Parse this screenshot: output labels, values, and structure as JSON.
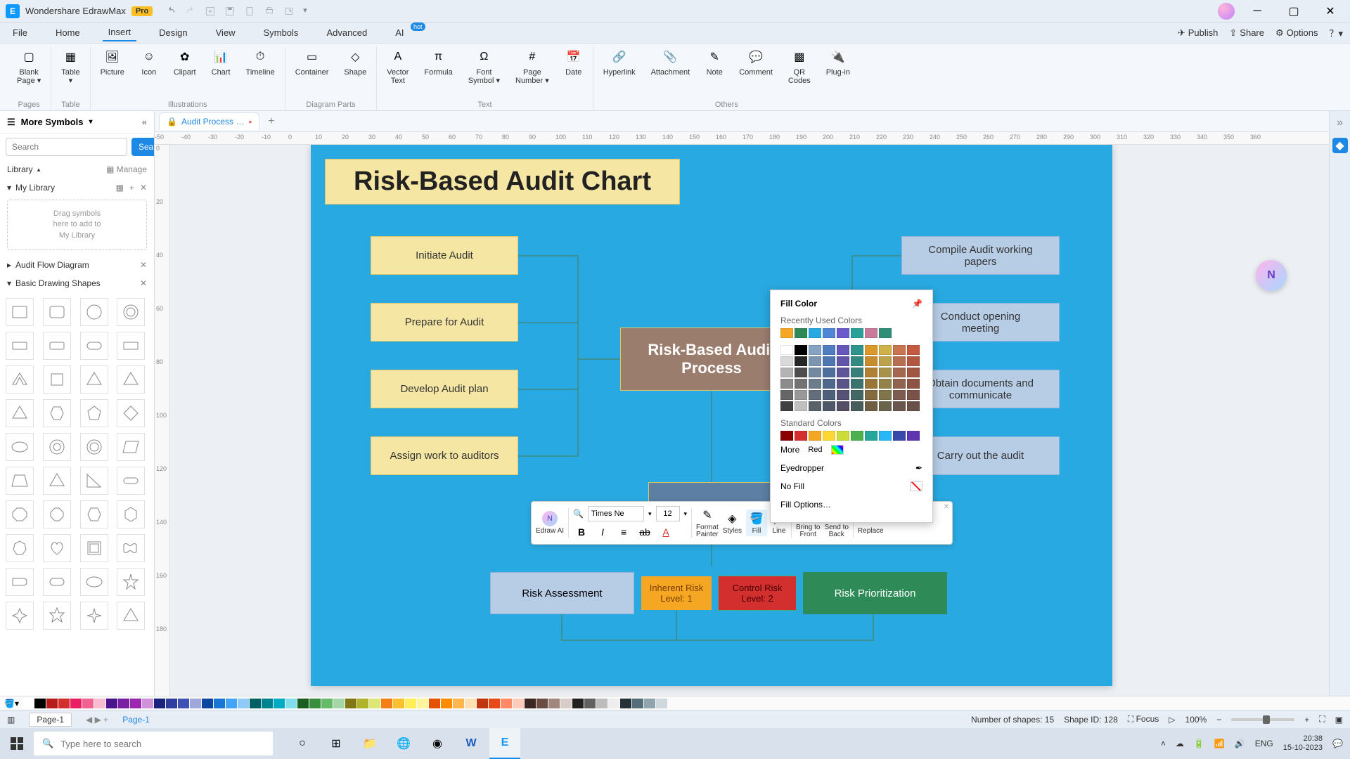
{
  "app": {
    "name": "Wondershare EdrawMax",
    "badge": "Pro"
  },
  "menu": {
    "items": [
      "File",
      "Home",
      "Insert",
      "Design",
      "View",
      "Symbols",
      "Advanced",
      "AI"
    ],
    "active": "Insert",
    "right": {
      "publish": "Publish",
      "share": "Share",
      "options": "Options"
    }
  },
  "ribbon": {
    "groups": [
      {
        "label": "Pages",
        "buttons": [
          {
            "name": "blank-page",
            "label": "Blank\nPage ▾"
          }
        ]
      },
      {
        "label": "Table",
        "buttons": [
          {
            "name": "table",
            "label": "Table\n▾"
          }
        ]
      },
      {
        "label": "Illustrations",
        "buttons": [
          {
            "name": "picture",
            "label": "Picture"
          },
          {
            "name": "icon",
            "label": "Icon"
          },
          {
            "name": "clipart",
            "label": "Clipart"
          },
          {
            "name": "chart",
            "label": "Chart"
          },
          {
            "name": "timeline",
            "label": "Timeline"
          }
        ]
      },
      {
        "label": "Diagram Parts",
        "buttons": [
          {
            "name": "container",
            "label": "Container"
          },
          {
            "name": "shape",
            "label": "Shape"
          }
        ]
      },
      {
        "label": "Text",
        "buttons": [
          {
            "name": "vector-text",
            "label": "Vector\nText"
          },
          {
            "name": "formula",
            "label": "Formula"
          },
          {
            "name": "font-symbol",
            "label": "Font\nSymbol ▾"
          },
          {
            "name": "page-number",
            "label": "Page\nNumber ▾"
          },
          {
            "name": "date",
            "label": "Date"
          }
        ]
      },
      {
        "label": "Others",
        "buttons": [
          {
            "name": "hyperlink",
            "label": "Hyperlink"
          },
          {
            "name": "attachment",
            "label": "Attachment"
          },
          {
            "name": "note",
            "label": "Note"
          },
          {
            "name": "comment",
            "label": "Comment"
          },
          {
            "name": "qr-codes",
            "label": "QR\nCodes"
          },
          {
            "name": "plugin",
            "label": "Plug-in"
          }
        ]
      }
    ]
  },
  "left_panel": {
    "title": "More Symbols",
    "search_placeholder": "Search",
    "search_btn": "Search",
    "library_label": "Library",
    "manage_label": "Manage",
    "mylibrary": "My Library",
    "dropzone": "Drag symbols\nhere to add to\nMy Library",
    "sections": [
      {
        "name": "audit-flow",
        "label": "Audit Flow Diagram"
      },
      {
        "name": "basic-shapes",
        "label": "Basic Drawing Shapes"
      }
    ]
  },
  "tabs": {
    "doc_name": "Audit Process …",
    "page_name": "Page-1"
  },
  "ruler_h": [
    "-50",
    "-40",
    "-30",
    "-20",
    "-10",
    "0",
    "10",
    "20",
    "30",
    "40",
    "50",
    "60",
    "70",
    "80",
    "90",
    "100",
    "110",
    "120",
    "130",
    "140",
    "150",
    "160",
    "170",
    "180",
    "190",
    "200",
    "210",
    "220",
    "230",
    "240",
    "250",
    "260",
    "270",
    "280",
    "290",
    "300",
    "310",
    "320",
    "330",
    "340",
    "350",
    "360"
  ],
  "ruler_v": [
    "0",
    "20",
    "40",
    "60",
    "80",
    "100",
    "120",
    "140",
    "160",
    "180"
  ],
  "diagram": {
    "title": "Risk-Based Audit Chart",
    "center": "Risk-Based Audit\nProcess",
    "left_nodes": [
      "Initiate Audit",
      "Prepare for Audit",
      "Develop Audit plan",
      "Assign work to auditors"
    ],
    "right_nodes": [
      "Compile Audit working\npapers",
      "Conduct opening\nmeeting",
      "Obtain documents and\ncommunicate",
      "Carry out the audit"
    ],
    "risk": {
      "assessment": "Risk Assessment",
      "inherent": "Inherent Risk\nLevel: 1",
      "control": "Control Risk\nLevel: 2",
      "prioritization": "Risk Prioritization"
    }
  },
  "float_toolbar": {
    "ai": "Edraw AI",
    "font": "Times Ne",
    "size": "12",
    "buttons": {
      "format_painter": "Format\nPainter",
      "styles": "Styles",
      "fill": "Fill",
      "line": "Line",
      "bring_front": "Bring to\nFront",
      "send_back": "Send to\nBack",
      "replace": "Replace"
    }
  },
  "fill_popup": {
    "title": "Fill Color",
    "recent": "Recently Used Colors",
    "recent_colors": [
      "#f5a623",
      "#2e8b57",
      "#29a9e1",
      "#4f86d6",
      "#6a5acd",
      "#2aa198",
      "#c97a9a",
      "#2f8f76"
    ],
    "standard": "Standard Colors",
    "standard_colors": [
      "#8b0000",
      "#d32f2f",
      "#f5a623",
      "#fdd835",
      "#cddc39",
      "#4caf50",
      "#26a69a",
      "#29b6f6",
      "#3949ab",
      "#5e35b1"
    ],
    "more": "More",
    "tooltip": "Red",
    "eyedropper": "Eyedropper",
    "nofill": "No Fill",
    "fillopts": "Fill Options…"
  },
  "statusbar": {
    "shapes": "Number of shapes: 15",
    "shape_id": "Shape ID: 128",
    "focus": "Focus",
    "zoom": "100%"
  },
  "colorbar_colors": [
    "#ffffff",
    "#000000",
    "#b71c1c",
    "#d32f2f",
    "#e91e63",
    "#f06292",
    "#f8bbd0",
    "#4a148c",
    "#7b1fa2",
    "#9c27b0",
    "#ce93d8",
    "#1a237e",
    "#303f9f",
    "#3f51b5",
    "#9fa8da",
    "#0d47a1",
    "#1976d2",
    "#42a5f5",
    "#90caf9",
    "#006064",
    "#00838f",
    "#00acc1",
    "#80deea",
    "#1b5e20",
    "#388e3c",
    "#66bb6a",
    "#a5d6a7",
    "#827717",
    "#afb42b",
    "#dce775",
    "#f57f17",
    "#fbc02d",
    "#ffee58",
    "#fff59d",
    "#e65100",
    "#fb8c00",
    "#ffb74d",
    "#ffe0b2",
    "#bf360c",
    "#e64a19",
    "#ff8a65",
    "#ffccbc",
    "#3e2723",
    "#6d4c41",
    "#a1887f",
    "#d7ccc8",
    "#212121",
    "#616161",
    "#bdbdbd",
    "#eeeeee",
    "#263238",
    "#546e7a",
    "#90a4ae",
    "#cfd8dc"
  ],
  "taskbar": {
    "search_placeholder": "Type here to search",
    "lang": "ENG",
    "time": "20:38",
    "date": "15-10-2023"
  }
}
